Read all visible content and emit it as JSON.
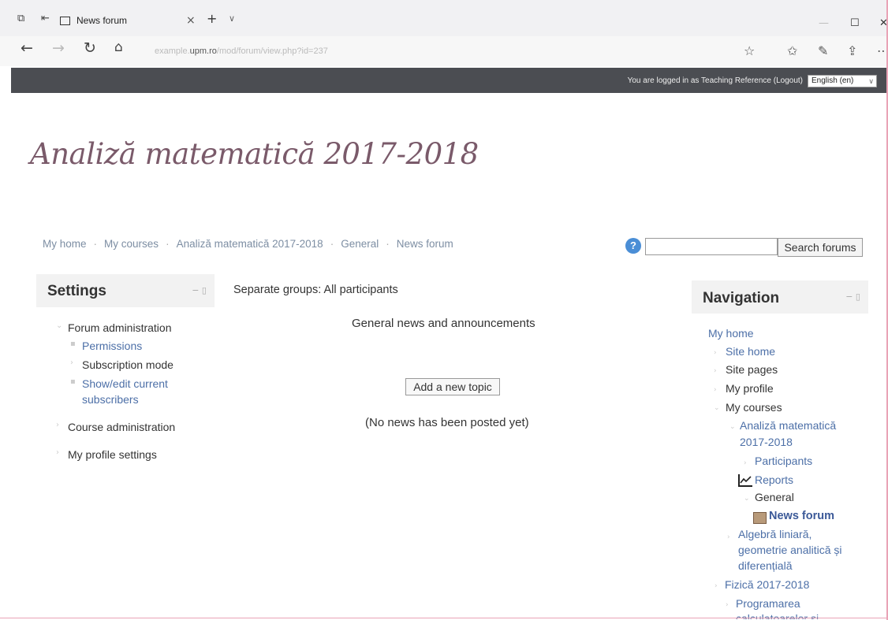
{
  "browser": {
    "tab_title": "News forum",
    "address_prefix": "example.",
    "address_host": "upm.ro",
    "address_path": "/mod/forum/view.php?id=237"
  },
  "header": {
    "login_info": "You are logged in as Teaching Reference (Logout)",
    "language": "English (en)"
  },
  "course_title": "Analiză matematică 2017-2018",
  "breadcrumb": [
    "My home",
    "My courses",
    "Analiză matematică 2017-2018",
    "General",
    "News forum"
  ],
  "search": {
    "button_label": "Search forums",
    "help": "?"
  },
  "settings": {
    "title": "Settings",
    "forum_admin": "Forum administration",
    "permissions": "Permissions",
    "subscription_mode": "Subscription mode",
    "show_edit_line1": "Show/edit current",
    "show_edit_line2": "subscribers",
    "course_admin": "Course administration",
    "profile_settings": "My profile settings"
  },
  "main": {
    "groups": "Separate groups: All participants",
    "intro": "General news and announcements",
    "add_topic": "Add a new topic",
    "no_news": "(No news has been posted yet)"
  },
  "navigation": {
    "title": "Navigation",
    "my_home": "My home",
    "site_home": "Site home",
    "site_pages": "Site pages",
    "my_profile": "My profile",
    "my_courses": "My courses",
    "course_line1": "Analiză matematică",
    "course_line2": "2017-2018",
    "participants": "Participants",
    "reports": "Reports",
    "general": "General",
    "news_forum": "News forum",
    "algebra_line1": "Algebră liniară,",
    "algebra_line2": "geometrie analitică și",
    "algebra_line3": "diferențială",
    "fizica": "Fizică 2017-2018",
    "programarea_line1": "Programarea",
    "programarea_line2": "calculatoarelor și"
  }
}
